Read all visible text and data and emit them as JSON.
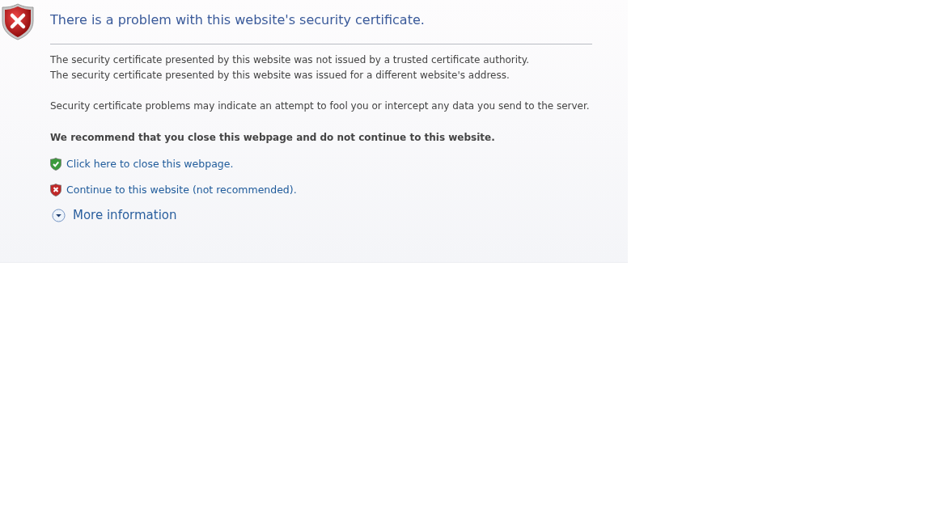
{
  "title": "There is a problem with this website's security certificate.",
  "reasons": [
    "The security certificate presented by this website was not issued by a trusted certificate authority.",
    "The security certificate presented by this website was issued for a different website's address."
  ],
  "warning": "Security certificate problems may indicate an attempt to fool you or intercept any data you send to the server.",
  "recommendation": "We recommend that you close this webpage and do not continue to this website.",
  "links": [
    {
      "kind": "safe",
      "label": "Click here to close this webpage."
    },
    {
      "kind": "unsafe",
      "label": "Continue to this website (not recommended)."
    }
  ],
  "more_info": {
    "label": "More information",
    "expanded": false
  }
}
